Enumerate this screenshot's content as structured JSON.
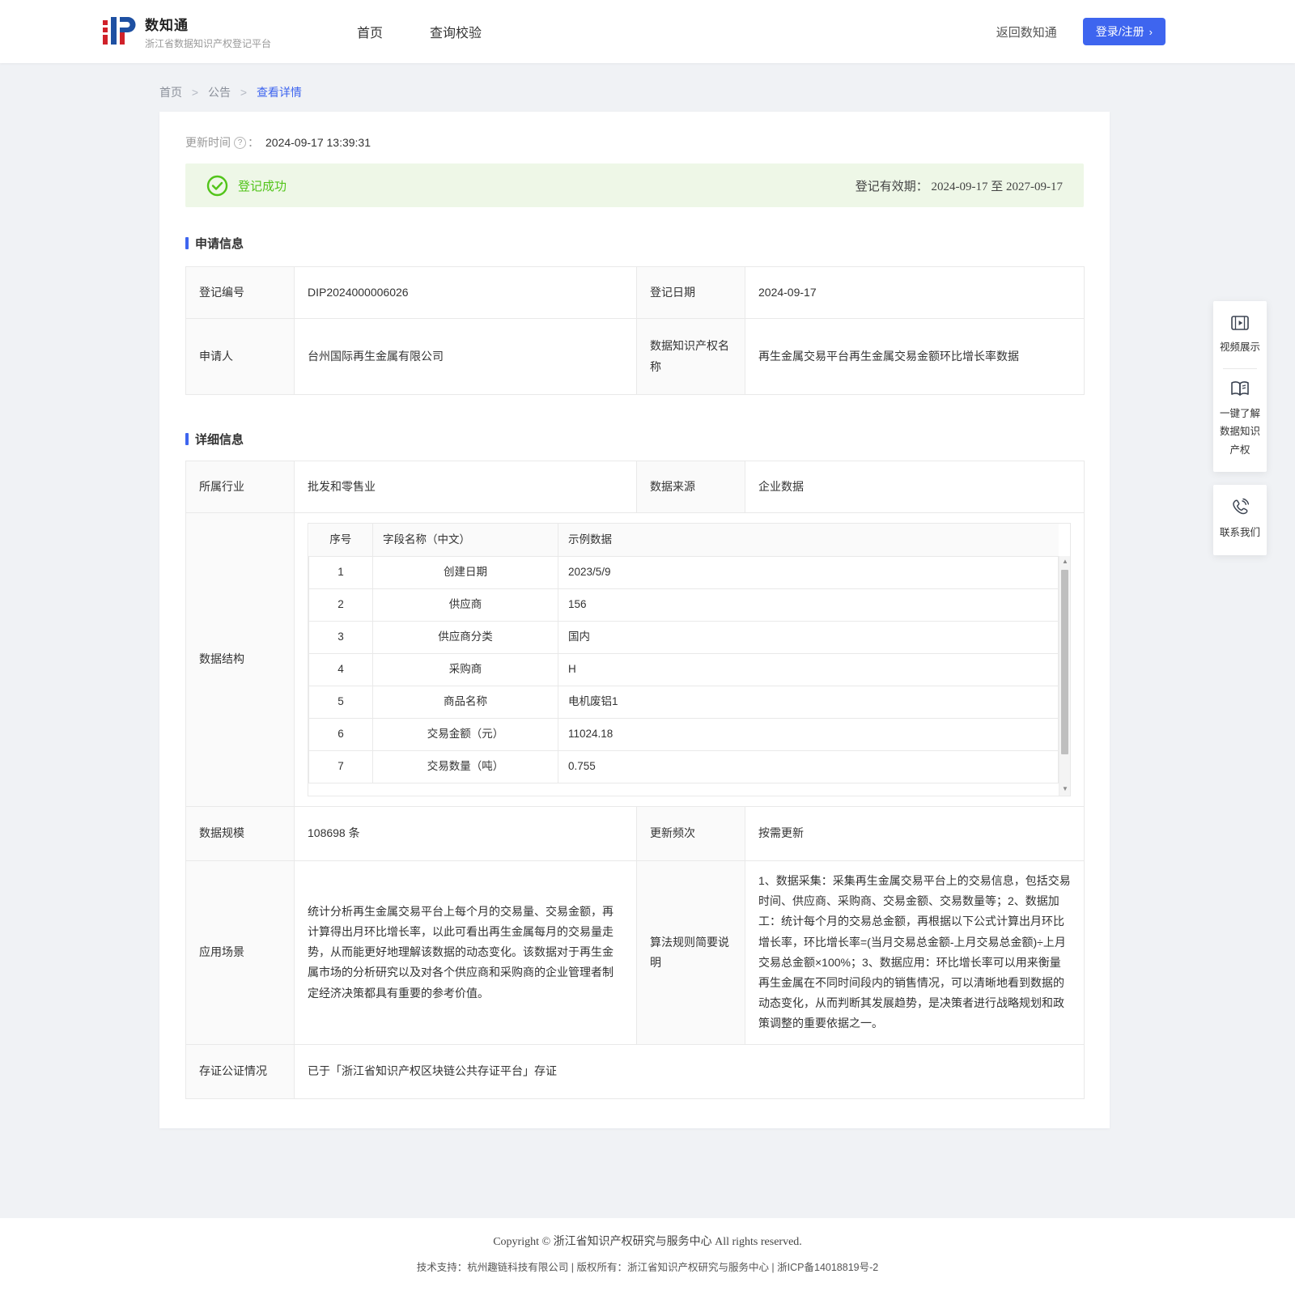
{
  "colors": {
    "primary": "#3e65ef",
    "success": "#52c41a",
    "success_bg": "#eef7e7",
    "logo_red": "#d0212a",
    "logo_blue": "#1e50a2"
  },
  "icons": {
    "question": "?",
    "login_arrow": "›",
    "scroll_up": "▲",
    "scroll_down": "▼",
    "breadcrumb_sep": ">"
  },
  "header": {
    "logo_title": "数知通",
    "logo_subtitle": "浙江省数据知识产权登记平台",
    "nav": [
      {
        "label": "首页"
      },
      {
        "label": "查询校验"
      }
    ],
    "back_link": "返回数知通",
    "login_label": "登录/注册"
  },
  "breadcrumb": {
    "items": [
      "首页",
      "公告",
      "查看详情"
    ]
  },
  "detail": {
    "update_time_label": "更新时间",
    "colon": "：",
    "update_time_value": "2024-09-17 13:39:31",
    "banner": {
      "status": "登记成功",
      "validity_label": "登记有效期：",
      "validity_value": "2024-09-17 至 2027-09-17"
    },
    "section_apply": "申请信息",
    "apply": {
      "reg_no_label": "登记编号",
      "reg_no": "DIP2024000006026",
      "reg_date_label": "登记日期",
      "reg_date": "2024-09-17",
      "applicant_label": "申请人",
      "applicant": "台州国际再生金属有限公司",
      "dip_name_label": "数据知识产权名称",
      "dip_name": "再生金属交易平台再生金属交易金额环比增长率数据"
    },
    "section_detail": "详细信息",
    "info": {
      "industry_label": "所属行业",
      "industry": "批发和零售业",
      "source_label": "数据来源",
      "source": "企业数据",
      "structure_label": "数据结构",
      "structure_table": {
        "headers": [
          "序号",
          "字段名称（中文）",
          "示例数据"
        ],
        "rows": [
          [
            "1",
            "创建日期",
            "2023/5/9"
          ],
          [
            "2",
            "供应商",
            "156"
          ],
          [
            "3",
            "供应商分类",
            "国内"
          ],
          [
            "4",
            "采购商",
            "H"
          ],
          [
            "5",
            "商品名称",
            "电机废铝1"
          ],
          [
            "6",
            "交易金额（元）",
            "11024.18"
          ],
          [
            "7",
            "交易数量（吨）",
            "0.755"
          ]
        ]
      },
      "scale_label": "数据规模",
      "scale": "108698 条",
      "freq_label": "更新频次",
      "freq": "按需更新",
      "scenario_label": "应用场景",
      "scenario": "统计分析再生金属交易平台上每个月的交易量、交易金额，再计算得出月环比增长率，以此可看出再生金属每月的交易量走势，从而能更好地理解该数据的动态变化。该数据对于再生金属市场的分析研究以及对各个供应商和采购商的企业管理者制定经济决策都具有重要的参考价值。",
      "algorithm_label": "算法规则简要说明",
      "algorithm": "1、数据采集：采集再生金属交易平台上的交易信息，包括交易时间、供应商、采购商、交易金额、交易数量等；2、数据加工：统计每个月的交易总金额，再根据以下公式计算出月环比增长率，环比增长率=(当月交易总金额-上月交易总金额)÷上月交易总金额×100%；3、数据应用：环比增长率可以用来衡量再生金属在不同时间段内的销售情况，可以清晰地看到数据的动态变化，从而判断其发展趋势，是决策者进行战略规划和政策调整的重要依据之一。",
      "evidence_label": "存证公证情况",
      "evidence": "已于「浙江省知识产权区块链公共存证平台」存证"
    }
  },
  "side_panel": {
    "video": "视频展示",
    "learn": "一键了解数据知识产权",
    "contact": "联系我们"
  },
  "footer": {
    "copyright": "Copyright © 浙江省知识产权研究与服务中心 All rights reserved.",
    "support": "技术支持：杭州趣链科技有限公司 | 版权所有：浙江省知识产权研究与服务中心 | 浙ICP备14018819号-2"
  }
}
